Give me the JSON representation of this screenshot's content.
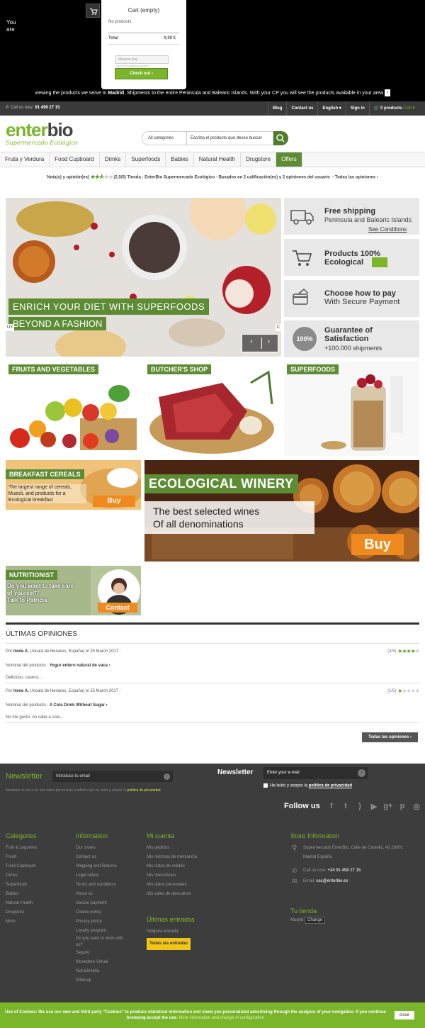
{
  "top": {
    "you_are_1": "You",
    "you_are_2": "are",
    "cart_title": "Cart (empty)",
    "no_products": "No products",
    "total_label": "Total",
    "total_value": "0,00 €",
    "amazon_label": "amazon pay",
    "amazon_note": "Use your Amazon account",
    "checkout_label": "Check out",
    "ship_note_pre": "viewing the products we serve in ",
    "ship_note_city": "Madrid",
    "ship_note_post": ". Shipments to the entire Peninsula and Balearic Islands. With your CP you will see the products available in your area"
  },
  "callbar": {
    "call_label": "Call us now:",
    "phone": "91 499 27 15",
    "nav": [
      "Blog",
      "Contact us",
      "English",
      "Sign in"
    ],
    "cart_count": "0 products",
    "cart_total": "0,00 €"
  },
  "header": {
    "logo_a": "enter",
    "logo_b": "bio",
    "tagline": "Supermercado Ecológico",
    "search_category": "All categories",
    "search_placeholder": "Escriba el producto que desee buscar"
  },
  "menu": [
    "Fruta y Verdura",
    "Food Cupboard",
    "Drinks",
    "Superfoods",
    "Babies",
    "Natural Health",
    "Drugstore",
    "Offers"
  ],
  "ratebar": {
    "label": "Nota(s) y opinión(es)",
    "score": "(2,5/5)",
    "text": "Tienda : EnterBio Supermercado Ecológico - Basados en 2 calificación(es) y 2 opiniones del usuario",
    "all": "Todas las opiniones"
  },
  "hero": {
    "line1": "ENRICH YOUR DIET WITH SUPERFOODS",
    "line2": "BEYOND A FASHION",
    "left_tag": "UY",
    "right_tag": "C"
  },
  "features": [
    {
      "title": "Free shipping",
      "sub": "Peninsula and Balearic Islands",
      "link": "See Conditions"
    },
    {
      "title": "Products 100%",
      "title2": "Ecological"
    },
    {
      "title": "Choose how to pay",
      "sub": "With Secure Payment"
    },
    {
      "badge": "100%",
      "title": "Guarantee of",
      "title2": "Satisfaction",
      "sub": "+100.000 shipments"
    }
  ],
  "categories": {
    "fruits": "FRUITS AND VEGETABLES",
    "butcher": "BUTCHER'S SHOP",
    "superfoods": "SUPERFOODS",
    "breakfast": "BREAKFAST CEREALS",
    "breakfast_text": "The largest range of cereals, Muesli, and products for a Ecological breakfast",
    "breakfast_buy": "Buy",
    "winery": "ECOLOGICAL WINERY",
    "winery_text1": "The best selected wines",
    "winery_text2": "Of all denominations",
    "winery_buy": "Buy",
    "nutritionist": "NUTRITIONIST",
    "nutri_text1": "Do you want to take care",
    "nutri_text2": "of yourself?",
    "nutri_text3": "Talk to Patricia",
    "nutri_contact": "Contact"
  },
  "opinions": {
    "heading": "ÚLTIMAS OPINIONES",
    "reviews": [
      {
        "by_pre": "Por",
        "author": "Irene A.",
        "meta": "(Alcalá de Henares, España) el 25 March 2017 :",
        "product_label": "Nominal del producto :",
        "product": "Yogur entero natural de vaca",
        "text": "Delicioso, casero,...",
        "score_label": "(4/5)",
        "stars": 4
      },
      {
        "by_pre": "Por",
        "author": "Irene A.",
        "meta": "(Alcalá de Henares, España) el 25 March 2017 :",
        "product_label": "Nominal del producto :",
        "product": "A Cola Drink Without Sugar",
        "text": "No me gustó, no sabe a cola...",
        "score_label": "(1/5)",
        "stars": 1
      }
    ],
    "all_button": "Todas las opiniones"
  },
  "footer": {
    "nl1_title": "Newsletter",
    "nl1_placeholder": "Introduce tu email",
    "nl_note_pre": "Mediante el envío de mis datos personales confirmo que he leído y acepto la ",
    "nl_note_link": "política de privacidad",
    "nl2_title": "Newsletter",
    "nl2_placeholder": "Enter your e-mail",
    "nl2_check_pre": "He leído y acepto la ",
    "nl2_check_link": "política de privacidad",
    "follow": "Follow us",
    "socials": [
      "f",
      "t",
      "rss",
      "yt",
      "g+",
      "p",
      "ig"
    ],
    "categories_title": "Categories",
    "categories": [
      "Fruit & Legumes",
      "Fresh",
      "Food Cupboard",
      "Drinks",
      "Superfoods",
      "Babies",
      "Natural Health",
      "Drugstore",
      "More"
    ],
    "info_title": "Information",
    "info": [
      "Our stores",
      "Contact us",
      "Shipping and Returns",
      "Legal notice",
      "Terms and conditions",
      "About us",
      "Secure payment",
      "Cookie policy",
      "Privacy policy",
      "Loyalty program",
      "Do you want to work with",
      "us?",
      "Seguro",
      "Monedero Virtual",
      "Nutricionista",
      "Sitemap"
    ],
    "account_title": "Mi cuenta",
    "account": [
      "Mis pedidos",
      "Mis retornos de mercancía",
      "Mis notas de crédito",
      "Mis direcciones",
      "Mis datos personales",
      "Mis vales de descuento"
    ],
    "entries_title": "Últimas entradas",
    "entries_none": "Ninguna entrada",
    "entries_button": "Todas las entradas",
    "store_title": "Store Information",
    "store_addr1": "Supermercado EnterBio, Calle de Castelló, 43 28001",
    "store_addr2": "Madrid España",
    "store_call_label": "Call us now:",
    "store_phone": "+34 91 499 27 15",
    "store_email_label": "Email:",
    "store_email": "sac@enterbio.es",
    "tu_tienda": "Tu tienda",
    "tu_city": "Madrid",
    "tu_change": "Change"
  },
  "cookie": {
    "text": "Use of Cookies: We use our own and third party \"Cookies\" to produce statistical information and show you personalized advertising through the analysis of your navigation. If you continue browsing accept the use.",
    "link": "More information and change of configuration",
    "close": "close"
  },
  "colors": {
    "accent": "#7ab52b",
    "dark_green": "#5d8c35",
    "orange": "#f08a1e",
    "footer_bg": "#3d3d3d"
  }
}
